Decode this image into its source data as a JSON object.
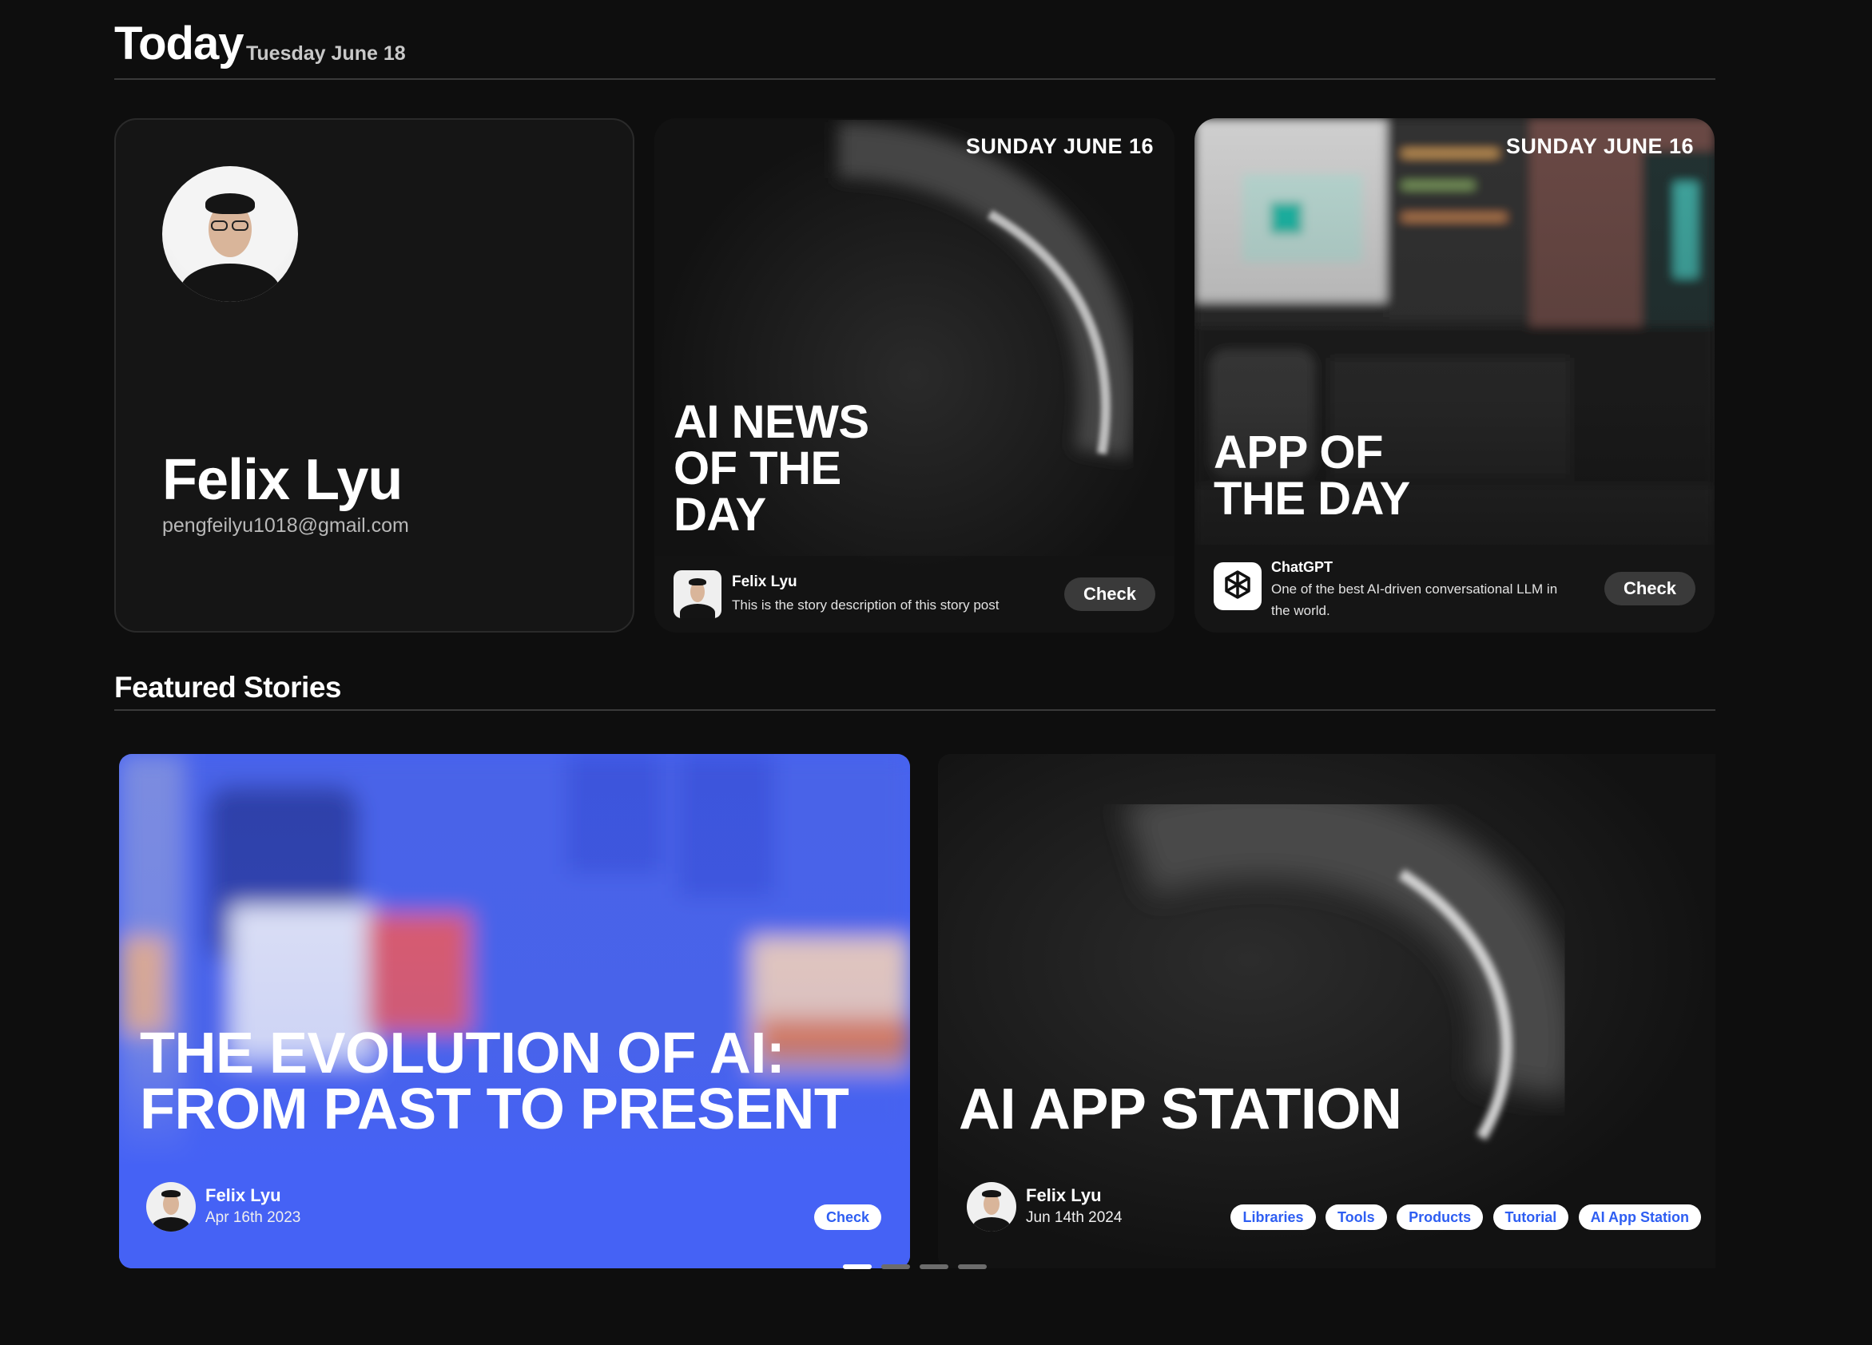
{
  "today": {
    "title": "Today",
    "date": "Tuesday June 18"
  },
  "profile": {
    "name": "Felix Lyu",
    "email": "pengfeilyu1018@gmail.com"
  },
  "news_card": {
    "date": "SUNDAY JUNE 16",
    "title_lines": [
      "AI NEWS",
      "OF THE",
      "DAY"
    ],
    "author": "Felix Lyu",
    "description": "This is the story description of this story post",
    "button": "Check"
  },
  "app_card": {
    "date": "SUNDAY JUNE 16",
    "title_lines": [
      "APP OF",
      "THE DAY"
    ],
    "app_name": "ChatGPT",
    "description_lines": [
      "One of the best AI-driven conversational LLM in",
      "the world."
    ],
    "button": "Check",
    "icon": "openai-logo-icon"
  },
  "featured": {
    "title": "Featured Stories",
    "stories": [
      {
        "title_lines": [
          "THE EVOLUTION OF AI:",
          "FROM PAST TO PRESENT"
        ],
        "author": "Felix Lyu",
        "date": "Apr 16th 2023",
        "button": "Check",
        "accent": "#4562f5"
      },
      {
        "title": "AI APP STATION",
        "author": "Felix Lyu",
        "date": "Jun 14th 2024",
        "tags": [
          "Libraries",
          "Tools",
          "Products",
          "Tutorial",
          "AI App Station"
        ]
      }
    ],
    "pagination": {
      "count": 4,
      "active": 0
    }
  }
}
